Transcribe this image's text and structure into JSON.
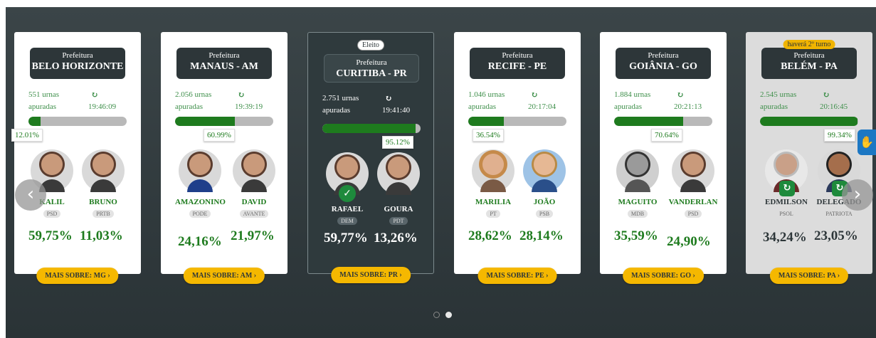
{
  "cards": [
    {
      "label": "Prefeitura",
      "city": "BELO HORIZONTE",
      "urnas": "551 urnas",
      "apuradas": "apuradas",
      "time": "19:46:09",
      "progress_pct": 12.01,
      "progress_label": "12.01%",
      "candidates": [
        {
          "name": "KALIL",
          "party": "PSD",
          "pct": "59,75%"
        },
        {
          "name": "BRUNO",
          "party": "PRTB",
          "pct": "11,03%"
        }
      ],
      "more": "MAIS SOBRE: MG ›"
    },
    {
      "label": "Prefeitura",
      "city": "MANAUS - AM",
      "urnas": "2.056 urnas",
      "apuradas": "apuradas",
      "time": "19:39:19",
      "progress_pct": 60.99,
      "progress_label": "60.99%",
      "candidates": [
        {
          "name": "AMAZONINO",
          "party": "PODE",
          "pct": "24,16%"
        },
        {
          "name": "DAVID",
          "party": "AVANTE",
          "pct": "21,97%"
        }
      ],
      "more": "MAIS SOBRE: AM ›"
    },
    {
      "badge": "Eleito",
      "label": "Prefeitura",
      "city": "CURITIBA - PR",
      "urnas": "2.751 urnas",
      "apuradas": "apuradas",
      "time": "19:41:40",
      "progress_pct": 95.12,
      "progress_label": "95.12%",
      "candidates": [
        {
          "name": "RAFAEL",
          "party": "DEM",
          "pct": "59,77%"
        },
        {
          "name": "GOURA",
          "party": "PDT",
          "pct": "13,26%"
        }
      ],
      "more": "MAIS SOBRE: PR ›"
    },
    {
      "label": "Prefeitura",
      "city": "RECIFE - PE",
      "urnas": "1.046 urnas",
      "apuradas": "apuradas",
      "time": "20:17:04",
      "progress_pct": 36.54,
      "progress_label": "36.54%",
      "candidates": [
        {
          "name": "MARILIA",
          "party": "PT",
          "pct": "28,62%"
        },
        {
          "name": "JOÃO",
          "party": "PSB",
          "pct": "28,14%"
        }
      ],
      "more": "MAIS SOBRE: PE ›"
    },
    {
      "label": "Prefeitura",
      "city": "GOIÂNIA - GO",
      "urnas": "1.884 urnas",
      "apuradas": "apuradas",
      "time": "20:21:13",
      "progress_pct": 70.64,
      "progress_label": "70.64%",
      "candidates": [
        {
          "name": "MAGUITO",
          "party": "MDB",
          "pct": "35,59%"
        },
        {
          "name": "VANDERLAN",
          "party": "PSD",
          "pct": "24,90%"
        }
      ],
      "more": "MAIS SOBRE: GO ›"
    },
    {
      "badge": "haverá 2º turno",
      "label": "Prefeitura",
      "city": "BELÉM - PA",
      "urnas": "2.545 urnas",
      "apuradas": "apuradas",
      "time": "20:16:45",
      "progress_pct": 99.34,
      "progress_label": "99.34%",
      "candidates": [
        {
          "name": "EDMILSON",
          "party": "PSOL",
          "pct": "34,24%"
        },
        {
          "name": "DELEGADO",
          "party": "PATRIOTA",
          "pct": "23,05%"
        }
      ],
      "more": "MAIS SOBRE: PA ›"
    }
  ],
  "nav": {
    "prev": "‹",
    "next": "›"
  },
  "icons": {
    "refresh": "refresh-icon",
    "check": "check-icon",
    "accessibility": "accessibility-icon"
  },
  "colors": {
    "green": "#1e7b1e",
    "yellow": "#f5b800",
    "dark": "#2d3639"
  }
}
